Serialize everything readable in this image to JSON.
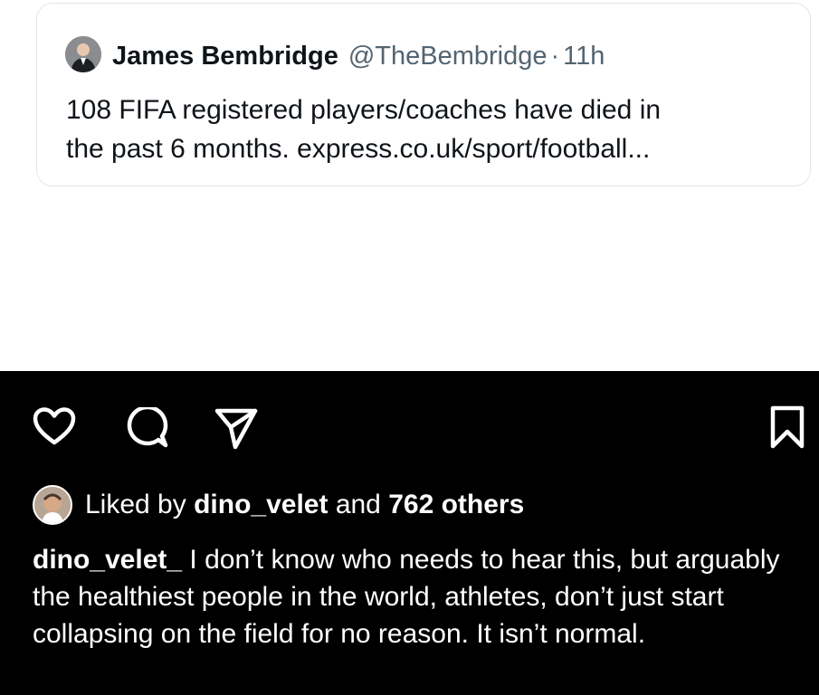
{
  "tweet": {
    "author_name": "James Bembridge",
    "handle": "@TheBembridge",
    "separator": "·",
    "time": "11h",
    "text_line1": "108 FIFA registered players/coaches have died in",
    "text_line2": "the past 6 months. express.co.uk/sport/football..."
  },
  "post": {
    "actions": {
      "like": "heart-icon",
      "comment": "comment-icon",
      "share": "send-icon",
      "save": "bookmark-icon"
    },
    "liked_by": {
      "prefix": "Liked by",
      "user": "dino_velet",
      "conjunction": "and",
      "count_text": "762 others"
    },
    "caption": {
      "username": "dino_velet_",
      "text": "I don’t know who needs to hear this, but arguably the healthiest people in the world, athletes, don’t just start collapsing on the field for no reason. It isn’t normal."
    }
  },
  "colors": {
    "dark_bg": "#000000",
    "card_border": "#e3e6ea",
    "handle_gray": "#536471"
  }
}
